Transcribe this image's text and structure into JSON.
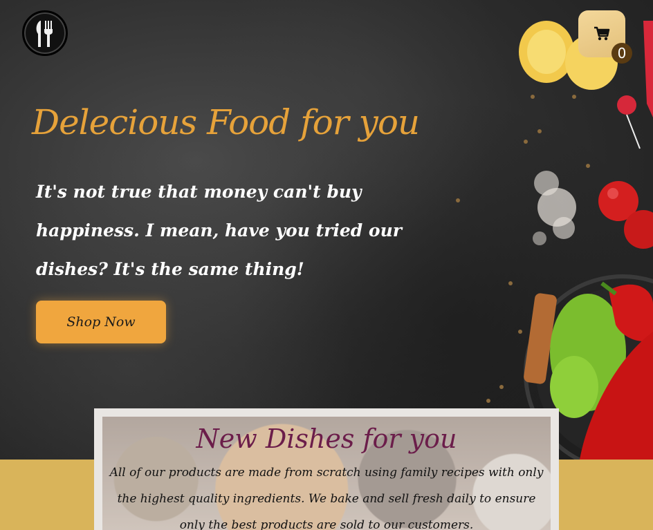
{
  "header": {
    "logo_icon": "fork-knife-icon",
    "cart_icon": "shopping-cart-icon",
    "cart_count": "0"
  },
  "hero": {
    "title": "Delecious Food for you",
    "tagline": "It's not true that money can't buy happiness. I mean, have you tried our dishes? It's the same thing!",
    "cta_label": "Shop Now"
  },
  "new_dishes": {
    "title": "New Dishes for you",
    "text": "All of our products are made from scratch using family recipes with only the highest quality ingredients. We bake and sell fresh daily to ensure only the best products are sold to our customers."
  },
  "colors": {
    "accent": "#e6a23a",
    "button": "#f0a63e",
    "section_bg": "#d9b45a",
    "section_title": "#6b1d4a"
  }
}
